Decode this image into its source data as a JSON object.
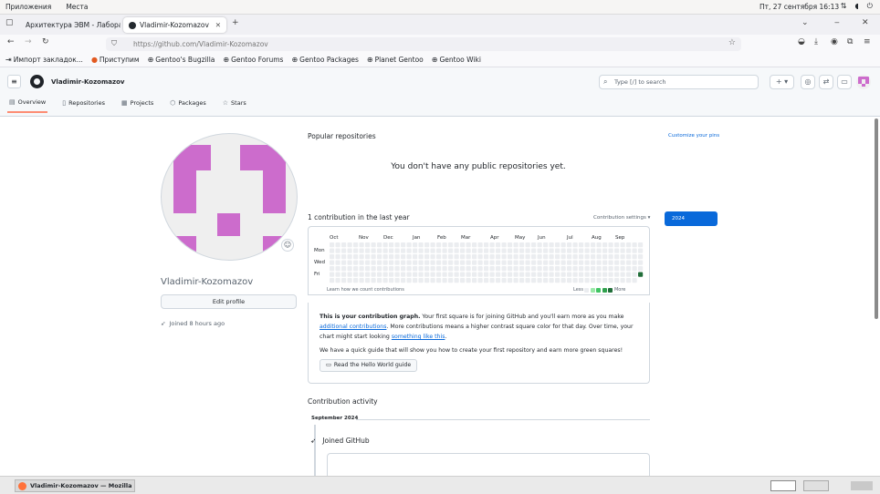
{
  "system": {
    "menu": [
      "Приложения",
      "Места"
    ],
    "clock": "Пт, 27 сентября  16:13",
    "tray_icons": [
      "network-icon",
      "volume-icon",
      "power-icon"
    ]
  },
  "browser": {
    "tabs": [
      {
        "title": "Архитектура ЭВМ - Лабора",
        "close": "✕"
      },
      {
        "title": "Vladimir-Kozomazov",
        "close": "✕"
      }
    ],
    "new_tab": "+",
    "url": "https://github.com/Vladimir-Kozomazov",
    "bookmarks": [
      "Импорт закладок...",
      "Приступим",
      "Gentoo's Bugzilla",
      "Gentoo Forums",
      "Gentoo Packages",
      "Planet Gentoo",
      "Gentoo Wiki"
    ]
  },
  "github": {
    "owner": "Vladimir-Kozomazov",
    "search_placeholder": "Type [/] to search",
    "tabs": [
      "Overview",
      "Repositories",
      "Projects",
      "Packages",
      "Stars"
    ],
    "login": "Vladimir-Kozomazov",
    "edit_profile": "Edit profile",
    "joined": "Joined 8 hours ago",
    "popular_heading": "Popular repositories",
    "customize_pins": "Customize your pins",
    "no_repos": "You don't have any public repositories yet.",
    "contrib_heading": "1 contribution in the last year",
    "contrib_settings": "Contribution settings ▾",
    "year": "2024",
    "months": [
      "Oct",
      "Nov",
      "Dec",
      "Jan",
      "Feb",
      "Mar",
      "Apr",
      "May",
      "Jun",
      "Jul",
      "Aug",
      "Sep"
    ],
    "days": [
      "Mon",
      "Wed",
      "Fri"
    ],
    "learn_link": "Learn how we count contributions",
    "legend_less": "Less",
    "legend_more": "More",
    "first_square": {
      "p1_strong": "This is your contribution graph.",
      "p1_a": " Your first square is for joining GitHub and you'll earn more as you make ",
      "p1_link1": "additional contributions",
      "p1_b": ". More contributions means a higher contrast square color for that day. Over time, your chart might start looking ",
      "p1_link2": "something like this",
      "p1_c": ".",
      "p2": "We have a quick guide that will show you how to create your first repository and earn more green squares!",
      "button": "Read the Hello World guide"
    },
    "activity_heading": "Contribution activity",
    "activity_month": "September 2024",
    "activity_item": "Joined GitHub"
  },
  "taskbar": {
    "window": "Vladimir-Kozomazov — Mozilla F..."
  },
  "colors": {
    "accent": "#0969da",
    "avatar": "#cc6ccc",
    "level0": "#ebedf0",
    "level4": "#216e39"
  }
}
